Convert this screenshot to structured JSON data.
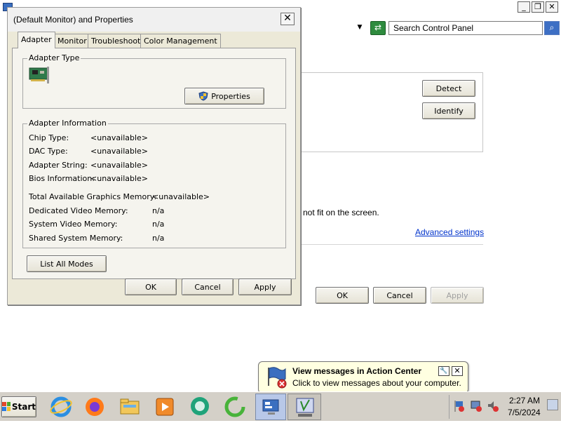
{
  "background_window": {
    "search_placeholder": "Search Control Panel",
    "detect_label": "Detect",
    "identify_label": "Identify",
    "partial_text": "not fit on the screen.",
    "advanced_link": "Advanced settings",
    "ok_label": "OK",
    "cancel_label": "Cancel",
    "apply_label": "Apply"
  },
  "dialog": {
    "title": "(Default Monitor) and  Properties",
    "close_glyph": "✕",
    "tabs": [
      {
        "label": "Adapter",
        "active": true
      },
      {
        "label": "Monitor"
      },
      {
        "label": "Troubleshoot"
      },
      {
        "label": "Color Management"
      }
    ],
    "adapter_type": {
      "legend": "Adapter Type",
      "properties_button": "Properties"
    },
    "adapter_info": {
      "legend": "Adapter Information",
      "rows": [
        {
          "label": "Chip Type:",
          "value": "<unavailable>"
        },
        {
          "label": "DAC Type:",
          "value": "<unavailable>"
        },
        {
          "label": "Adapter String:",
          "value": "<unavailable>"
        },
        {
          "label": "Bios Information:",
          "value": "<unavailable>"
        }
      ],
      "memory_rows": [
        {
          "label": "Total Available Graphics Memory:",
          "value": "<unavailable>"
        },
        {
          "label": "Dedicated Video Memory:",
          "value": "n/a"
        },
        {
          "label": "System Video Memory:",
          "value": "n/a"
        },
        {
          "label": "Shared System Memory:",
          "value": "n/a"
        }
      ]
    },
    "list_all_modes": "List All Modes",
    "ok": "OK",
    "cancel": "Cancel",
    "apply": "Apply"
  },
  "notification": {
    "title": "View messages in Action Center",
    "body": "Click to view messages about your computer."
  },
  "taskbar": {
    "start_label": "Start",
    "time": "2:27 AM",
    "date": "7/5/2024"
  },
  "colors": {
    "link": "#0033cc",
    "taskbar": "#d4d0c8",
    "dialog_face": "#ece9d8"
  }
}
